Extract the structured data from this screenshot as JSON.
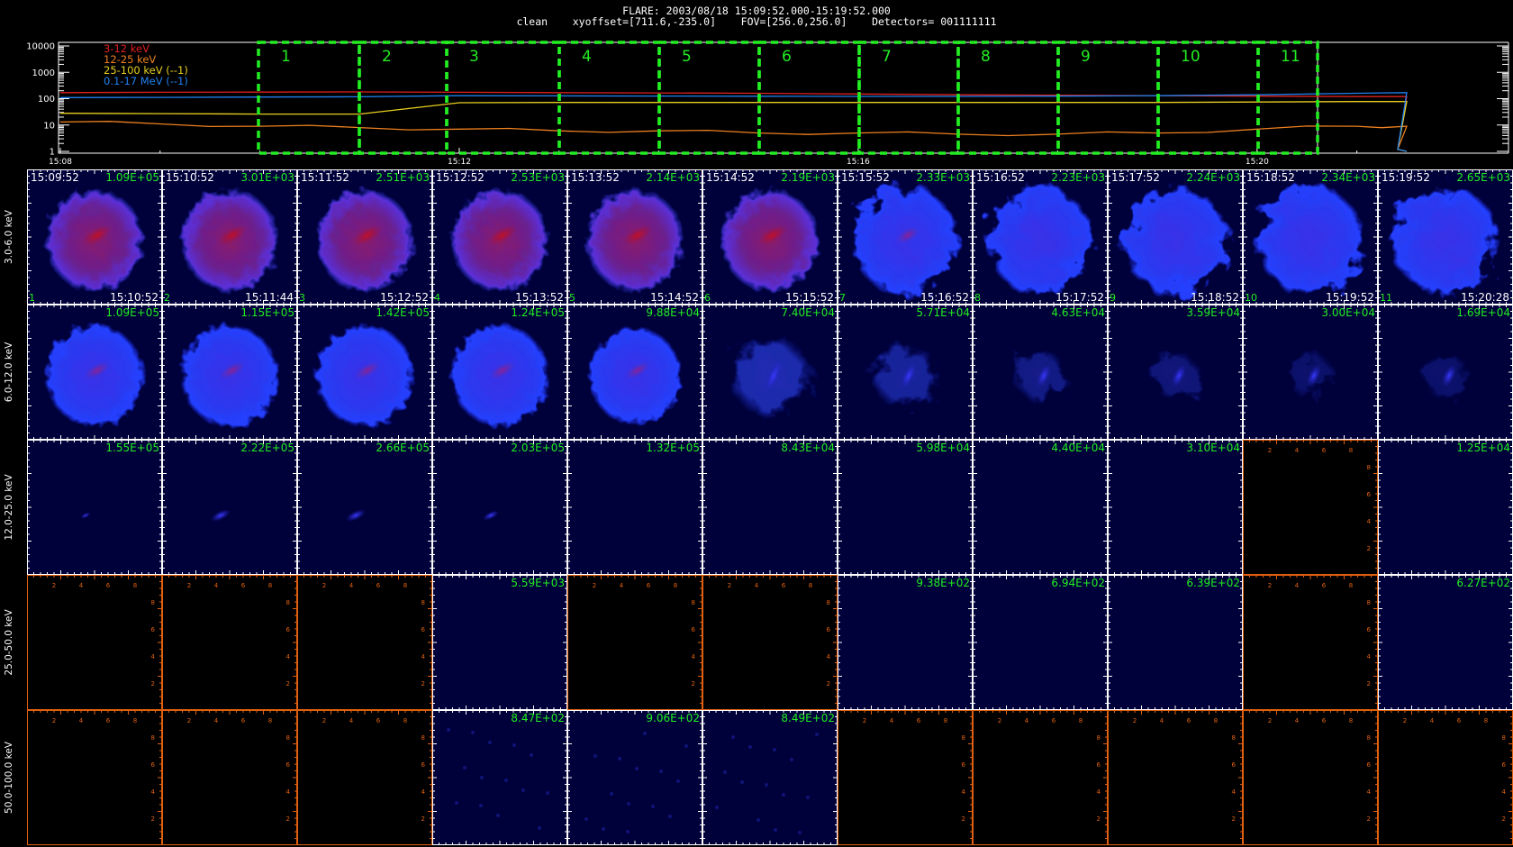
{
  "header": {
    "line1": "FLARE: 2003/08/18 15:09:52.000-15:19:52.000",
    "line2": "clean    xyoffset=[711.6,-235.0]    FOV=[256.0,256.0]    Detectors= 001111111"
  },
  "colors": {
    "c3_12": "#e02020",
    "c12_25": "#ee8020",
    "c25_100": "#e8d020",
    "c01_17": "#2080f0",
    "intervalBox": "#22ee22",
    "imageLabel": "#22ee22",
    "axisRed": "#e06010"
  },
  "chart_data": [
    {
      "type": "line",
      "ylog": true,
      "yticks": [
        "10000",
        "1000",
        "100",
        "10",
        "1"
      ],
      "ylim": [
        1,
        10000
      ],
      "xticks": [
        "15:08",
        "15:12",
        "15:16",
        "15:20"
      ],
      "legend": [
        {
          "label": "3-12 keV",
          "color": "#e02020"
        },
        {
          "label": "12-25 keV",
          "color": "#ee8020"
        },
        {
          "label": "25-100 keV (--1)",
          "color": "#e8d020"
        },
        {
          "label": "0.1-17 MeV (--1)",
          "color": "#2080f0"
        }
      ],
      "series": [
        {
          "name": "3-12 keV",
          "color": "#e02020",
          "x": [
            "15:08",
            "15:09",
            "15:10",
            "15:11",
            "15:12",
            "15:13",
            "15:14",
            "15:15",
            "15:16",
            "15:17",
            "15:18",
            "15:19",
            "15:20",
            "15:21",
            "15:21:30"
          ],
          "values": [
            170,
            175,
            178,
            180,
            175,
            170,
            165,
            160,
            150,
            140,
            135,
            130,
            125,
            120,
            120
          ]
        },
        {
          "name": "12-25 keV",
          "color": "#ee8020",
          "x": [
            "15:08",
            "15:09",
            "15:10",
            "15:11",
            "15:12",
            "15:13",
            "15:14",
            "15:15",
            "15:16",
            "15:17",
            "15:18",
            "15:19",
            "15:20",
            "15:21",
            "15:21:30"
          ],
          "values": [
            13,
            11,
            9,
            8,
            7,
            6,
            6,
            5,
            5,
            4.5,
            4.5,
            5,
            7,
            9,
            9
          ]
        },
        {
          "name": "25-100 keV (--1)",
          "color": "#e8d020",
          "x": [
            "15:08",
            "15:09",
            "15:10",
            "15:11",
            "15:12",
            "15:13",
            "15:14",
            "15:15",
            "15:16",
            "15:17",
            "15:18",
            "15:19",
            "15:20",
            "15:21",
            "15:21:30"
          ],
          "values": [
            28,
            27,
            26,
            26,
            70,
            72,
            72,
            72,
            72,
            72,
            72,
            72,
            75,
            78,
            78
          ]
        },
        {
          "name": "0.1-17 MeV (--1)",
          "color": "#2080f0",
          "x": [
            "15:08",
            "15:09",
            "15:10",
            "15:11",
            "15:12",
            "15:13",
            "15:14",
            "15:15",
            "15:16",
            "15:17",
            "15:18",
            "15:19",
            "15:20",
            "15:21",
            "15:21:30"
          ],
          "values": [
            110,
            112,
            115,
            118,
            130,
            128,
            126,
            124,
            122,
            122,
            125,
            130,
            140,
            160,
            170
          ]
        }
      ],
      "intervals": [
        "1",
        "2",
        "3",
        "4",
        "5",
        "6",
        "7",
        "8",
        "9",
        "10",
        "11"
      ]
    },
    {
      "type": "heatmap",
      "rows": [
        "3.0-6.0 keV",
        "6.0-12.0 keV",
        "12.0-25.0 keV",
        "25.0-50.0 keV",
        "50.0-100.0 keV"
      ],
      "start_times": [
        "15:09:52",
        "15:10:52",
        "15:11:52",
        "15:12:52",
        "15:13:52",
        "15:14:52",
        "15:15:52",
        "15:16:52",
        "15:17:52",
        "15:18:52",
        "15:19:52"
      ],
      "end_times": [
        "15:10:52",
        "15:11:44",
        "15:12:52",
        "15:13:52",
        "15:14:52",
        "15:15:52",
        "15:16:52",
        "15:17:52",
        "15:18:52",
        "15:19:52",
        "15:20:28"
      ],
      "indices": [
        "1",
        "2",
        "3",
        "4",
        "5",
        "6",
        "7",
        "8",
        "9",
        "10",
        "11"
      ],
      "peaks": [
        [
          "1.09E+05",
          "3.01E+03",
          "2.51E+03",
          "2.53E+03",
          "2.14E+03",
          "2.19E+03",
          "2.33E+03",
          "2.23E+03",
          "2.24E+03",
          "2.34E+03",
          "2.65E+03"
        ],
        [
          "1.09E+05",
          "1.15E+05",
          "1.42E+05",
          "1.24E+05",
          "9.88E+04",
          "7.40E+04",
          "5.71E+04",
          "4.63E+04",
          "3.59E+04",
          "3.00E+04",
          "1.69E+04"
        ],
        [
          "1.55E+05",
          "2.22E+05",
          "2.66E+05",
          "2.03E+05",
          "1.32E+05",
          "8.43E+04",
          "5.98E+04",
          "4.40E+04",
          "3.10E+04",
          "",
          "1.25E+04"
        ],
        [
          "",
          "",
          "",
          "5.59E+03",
          "",
          "",
          "9.38E+02",
          "6.94E+02",
          "6.39E+02",
          "",
          "6.27E+02"
        ],
        [
          "",
          "",
          "",
          "8.47E+02",
          "9.06E+02",
          "8.49E+02",
          "",
          "",
          "",
          "",
          ""
        ]
      ],
      "empty_tick_labels": [
        "2",
        "4",
        "6",
        "8"
      ]
    }
  ]
}
